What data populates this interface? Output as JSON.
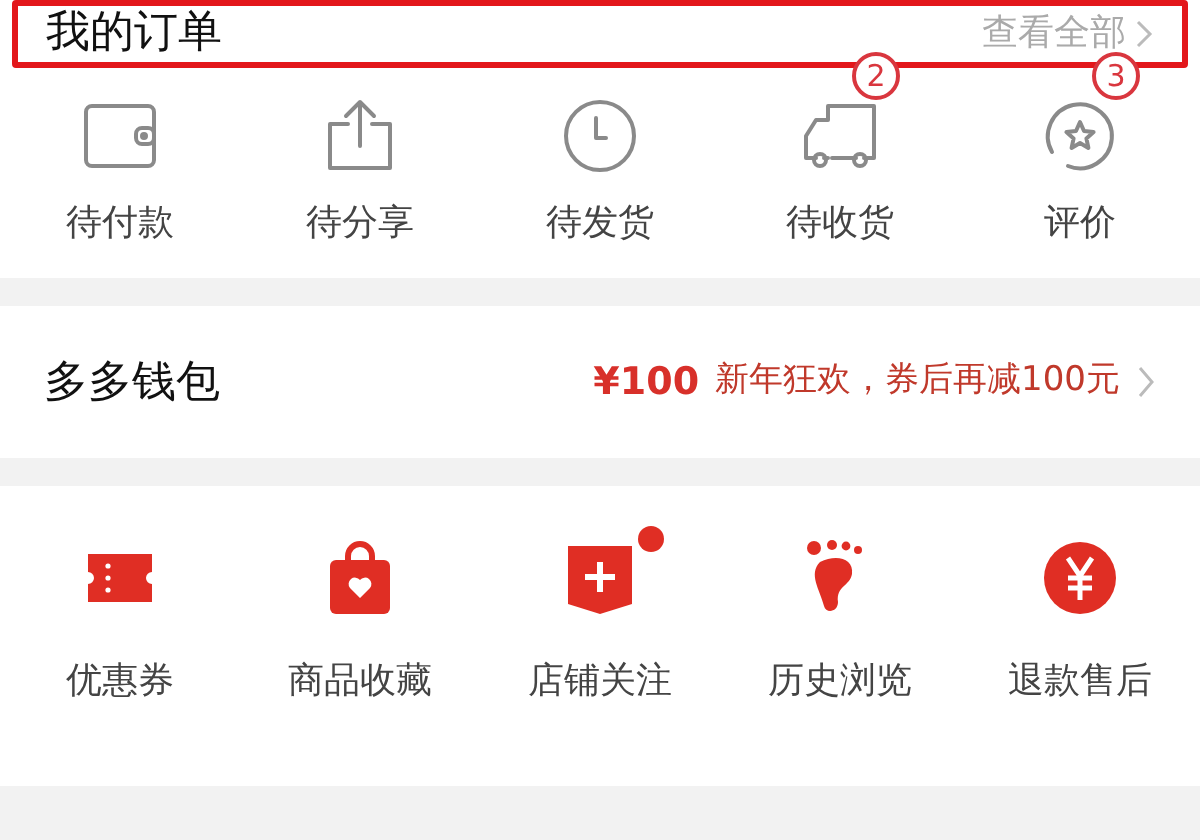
{
  "orders": {
    "title": "我的订单",
    "view_all": "查看全部",
    "highlighted": true,
    "items": [
      {
        "kind": "wallet",
        "label": "待付款"
      },
      {
        "kind": "share",
        "label": "待分享"
      },
      {
        "kind": "clock",
        "label": "待发货"
      },
      {
        "kind": "truck",
        "label": "待收货",
        "badge": "2"
      },
      {
        "kind": "review",
        "label": "评价",
        "badge": "3"
      }
    ]
  },
  "wallet": {
    "title": "多多钱包",
    "amount": "¥100",
    "promo": "新年狂欢，券后再减100元"
  },
  "services": [
    {
      "kind": "coupon",
      "label": "优惠券",
      "dot": false
    },
    {
      "kind": "bag",
      "label": "商品收藏",
      "dot": false
    },
    {
      "kind": "store",
      "label": "店铺关注",
      "dot": true
    },
    {
      "kind": "foot",
      "label": "历史浏览",
      "dot": false
    },
    {
      "kind": "yen",
      "label": "退款售后",
      "dot": false
    }
  ]
}
